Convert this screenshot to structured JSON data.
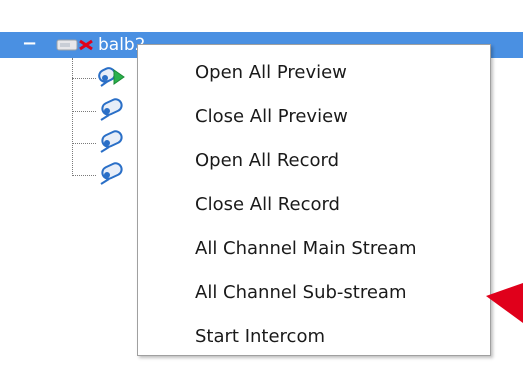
{
  "tree": {
    "root": {
      "label": "balb2",
      "toggle_symbol": "−",
      "icon": "device-icon"
    },
    "channels": [
      {
        "icon": "camera-preview-icon",
        "active": true
      },
      {
        "icon": "camera-icon",
        "active": false
      },
      {
        "icon": "camera-icon",
        "active": false
      },
      {
        "icon": "camera-icon",
        "active": false
      }
    ]
  },
  "context_menu": {
    "items": [
      {
        "label": "Open All Preview"
      },
      {
        "label": "Close All Preview"
      },
      {
        "label": "Open All Record"
      },
      {
        "label": "Close All Record"
      },
      {
        "label": "All Channel Main Stream"
      },
      {
        "label": "All Channel Sub-stream"
      },
      {
        "label": "Start Intercom"
      }
    ]
  },
  "colors": {
    "selection": "#4a90e2",
    "annotation_arrow": "#e0001b",
    "camera_body": "#2a6fc7",
    "preview_green": "#2bb24c"
  }
}
